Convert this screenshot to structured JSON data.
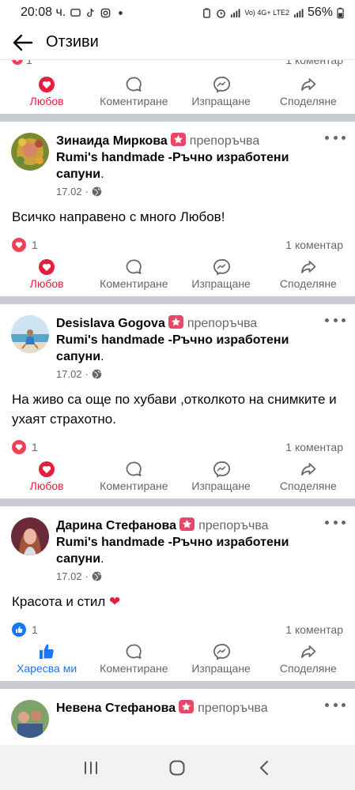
{
  "status_bar": {
    "time": "20:08 ч.",
    "network": "Vo) 4G+ LTE2",
    "battery": "56%"
  },
  "header": {
    "title": "Отзиви"
  },
  "partial": {
    "reaction_count": "1",
    "comments": "1 коментар"
  },
  "actions": {
    "love": "Любов",
    "like": "Харесва ми",
    "comment": "Коментиране",
    "send": "Изпращане",
    "share": "Споделяне"
  },
  "posts": [
    {
      "author": "Зинаида Миркова",
      "recommends": "препоръчва",
      "page": "Rumi's handmade -Ръчно изработени сапуни",
      "date": "17.02",
      "text": "Всичко направено с много Любов!",
      "reaction_count": "1",
      "comments": "1 коментар",
      "reaction_type": "love",
      "my_reaction": "love"
    },
    {
      "author": "Desislava Gogova",
      "recommends": "препоръчва",
      "page": "Rumi's handmade -Ръчно изработени сапуни",
      "date": "17.02",
      "text": "На живо са още по хубави ,отколкото на снимките и ухаят страхотно.",
      "reaction_count": "1",
      "comments": "1 коментар",
      "reaction_type": "love",
      "my_reaction": "love"
    },
    {
      "author": "Дарина Стефанова",
      "recommends": "препоръчва",
      "page": "Rumi's handmade -Ръчно изработени сапуни",
      "date": "17.02",
      "text": "Красота и стил",
      "emoji": "❤",
      "reaction_count": "1",
      "comments": "1 коментар",
      "reaction_type": "like",
      "my_reaction": "like"
    },
    {
      "author": "Невена Стефанова",
      "recommends": "препоръчва"
    }
  ],
  "colors": {
    "love": "#e41e3f",
    "like": "#1877f2",
    "muted": "#65676b",
    "divider": "#c9ccd1",
    "badge": "#e9476a"
  },
  "icons": {
    "back": "arrow-left-icon",
    "love": "heart-icon",
    "comment": "speech-bubble-icon",
    "send": "messenger-icon",
    "share": "share-arrow-icon",
    "globe": "globe-icon",
    "more": "more-dots-icon",
    "recommend": "recommend-star-icon"
  }
}
